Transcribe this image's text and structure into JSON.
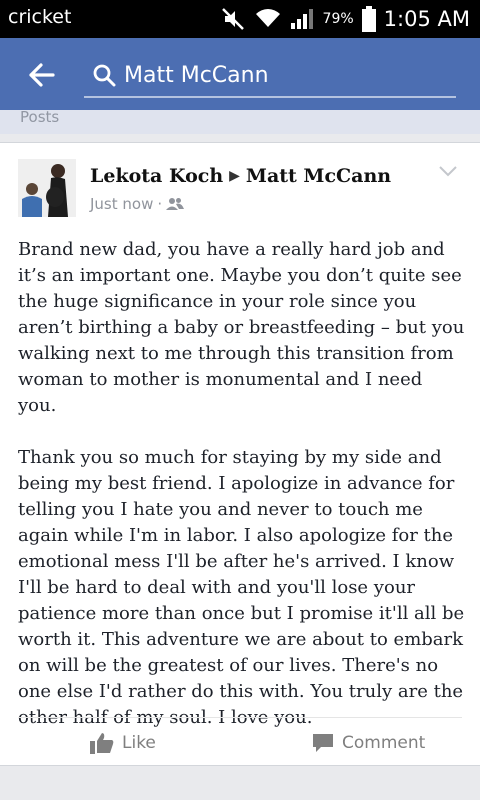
{
  "status_bar": {
    "carrier": "cricket",
    "battery": "79%",
    "time": "1:05 AM"
  },
  "search": {
    "query": "Matt McCann"
  },
  "section": {
    "label": "Posts"
  },
  "post": {
    "author": "Lekota Koch",
    "target": "Matt McCann",
    "timestamp": "Just now",
    "paragraphs": [
      "Brand new dad, you have a really hard job and it’s an important one. Maybe you don’t quite see the huge significance in your role since you aren’t birthing a baby or breastfeeding – but you walking next to me through this transition from woman to mother is monumental and I need you.",
      "Thank you so much for staying by my side and being my best friend. I apologize in advance for telling you I hate you and never to touch me again while I'm in labor. I also apologize for the emotional mess I'll be after he's arrived. I know I'll be hard to deal with and you'll lose your patience more than once but I promise it'll all be worth it. This adventure we are about to embark on will be the greatest of our lives. There's no one else I'd rather do this with. You truly are the other half of my soul. I love you."
    ],
    "actions": {
      "like": "Like",
      "comment": "Comment"
    }
  },
  "icons": {
    "back": "arrow-left-icon",
    "search": "search-icon",
    "audience": "friends-icon",
    "options": "chevron-down-icon"
  },
  "colors": {
    "app_bar": "#4c6eb2",
    "status_bar": "#000000"
  }
}
